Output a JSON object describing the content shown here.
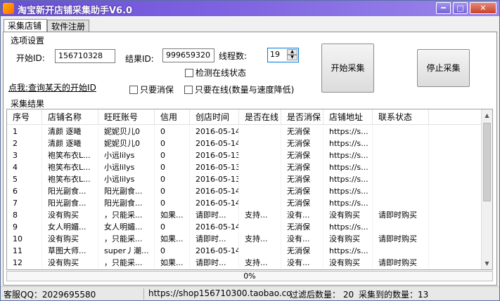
{
  "window": {
    "title": "淘宝新开店铺采集助手V6.0",
    "min_label": "━",
    "max_label": "□",
    "close_label": "✕"
  },
  "tabs": [
    {
      "label": "采集店铺"
    },
    {
      "label": "软件注册"
    }
  ],
  "options": {
    "group_label": "选项设置",
    "start_id_label": "开始ID:",
    "start_id_value": "156710328",
    "result_id_label": "结果ID:",
    "result_id_value": "999659320",
    "threads_label": "线程数:",
    "threads_value": "19",
    "check_online_label": "检测在线状态",
    "only_noconsume_label": "只要消保",
    "only_online_label": "只要在线(数量与速度降低)",
    "hint_prefix": "点我:",
    "hint_link": "查询某天的开始ID",
    "start_button": "开始采集",
    "stop_button": "停止采集"
  },
  "results": {
    "group_label": "采集结果",
    "columns": [
      "序号",
      "店铺名称",
      "旺旺账号",
      "信用",
      "创店时间",
      "是否在线",
      "是否消保",
      "店铺地址",
      "联系状态"
    ],
    "rows": [
      [
        "1",
        "清颜 逐曦",
        "妮妮贝儿0",
        "0",
        "2016-05-14",
        "",
        "无消保",
        "https://s...",
        ""
      ],
      [
        "2",
        "清颜 逐曦",
        "妮妮贝儿0",
        "0",
        "2016-05-14",
        "",
        "无消保",
        "https://s...",
        ""
      ],
      [
        "3",
        "袍笑布衣L...",
        "小远lilys",
        "0",
        "2016-05-13",
        "",
        "无消保",
        "https://s...",
        ""
      ],
      [
        "4",
        "袍笑布衣L...",
        "小远lilys",
        "0",
        "2016-05-13",
        "",
        "无消保",
        "https://s...",
        ""
      ],
      [
        "5",
        "袍笑布衣L...",
        "小远lilys",
        "0",
        "2016-05-13",
        "",
        "无消保",
        "https://s...",
        ""
      ],
      [
        "6",
        "阳光副食...",
        "阳光副食...",
        "0",
        "2016-05-14",
        "",
        "无消保",
        "https://s...",
        ""
      ],
      [
        "7",
        "阳光副食...",
        "阳光副食...",
        "0",
        "2016-05-14",
        "",
        "无消保",
        "https://s...",
        ""
      ],
      [
        "8",
        "没有购买",
        "，只能采...",
        "如果...",
        "请即时...",
        "支持...",
        "没有...",
        "没有购买",
        "请即时购买"
      ],
      [
        "9",
        "女人明媚...",
        "女人明媚...",
        "0",
        "2016-05-14",
        "",
        "无消保",
        "https://s...",
        ""
      ],
      [
        "10",
        "没有购买",
        "，只能采...",
        "如果...",
        "请即时...",
        "支持...",
        "没有...",
        "没有购买",
        "请即时购买"
      ],
      [
        "11",
        "草图大师...",
        "super丿潮...",
        "0",
        "2016-05-14",
        "",
        "无消保",
        "https://s...",
        ""
      ],
      [
        "12",
        "没有购买",
        "，只能采...",
        "如果...",
        "请即时...",
        "支持...",
        "没有...",
        "没有购买",
        "请即时购买"
      ]
    ]
  },
  "progress": {
    "text": "0%",
    "value": 0
  },
  "statusbar": {
    "qq": "客服QQ：2029695580",
    "url": "https://shop156710300.taobao.co",
    "filtered": "过滤后数量： 20",
    "collected": "采集到的数量：13"
  }
}
